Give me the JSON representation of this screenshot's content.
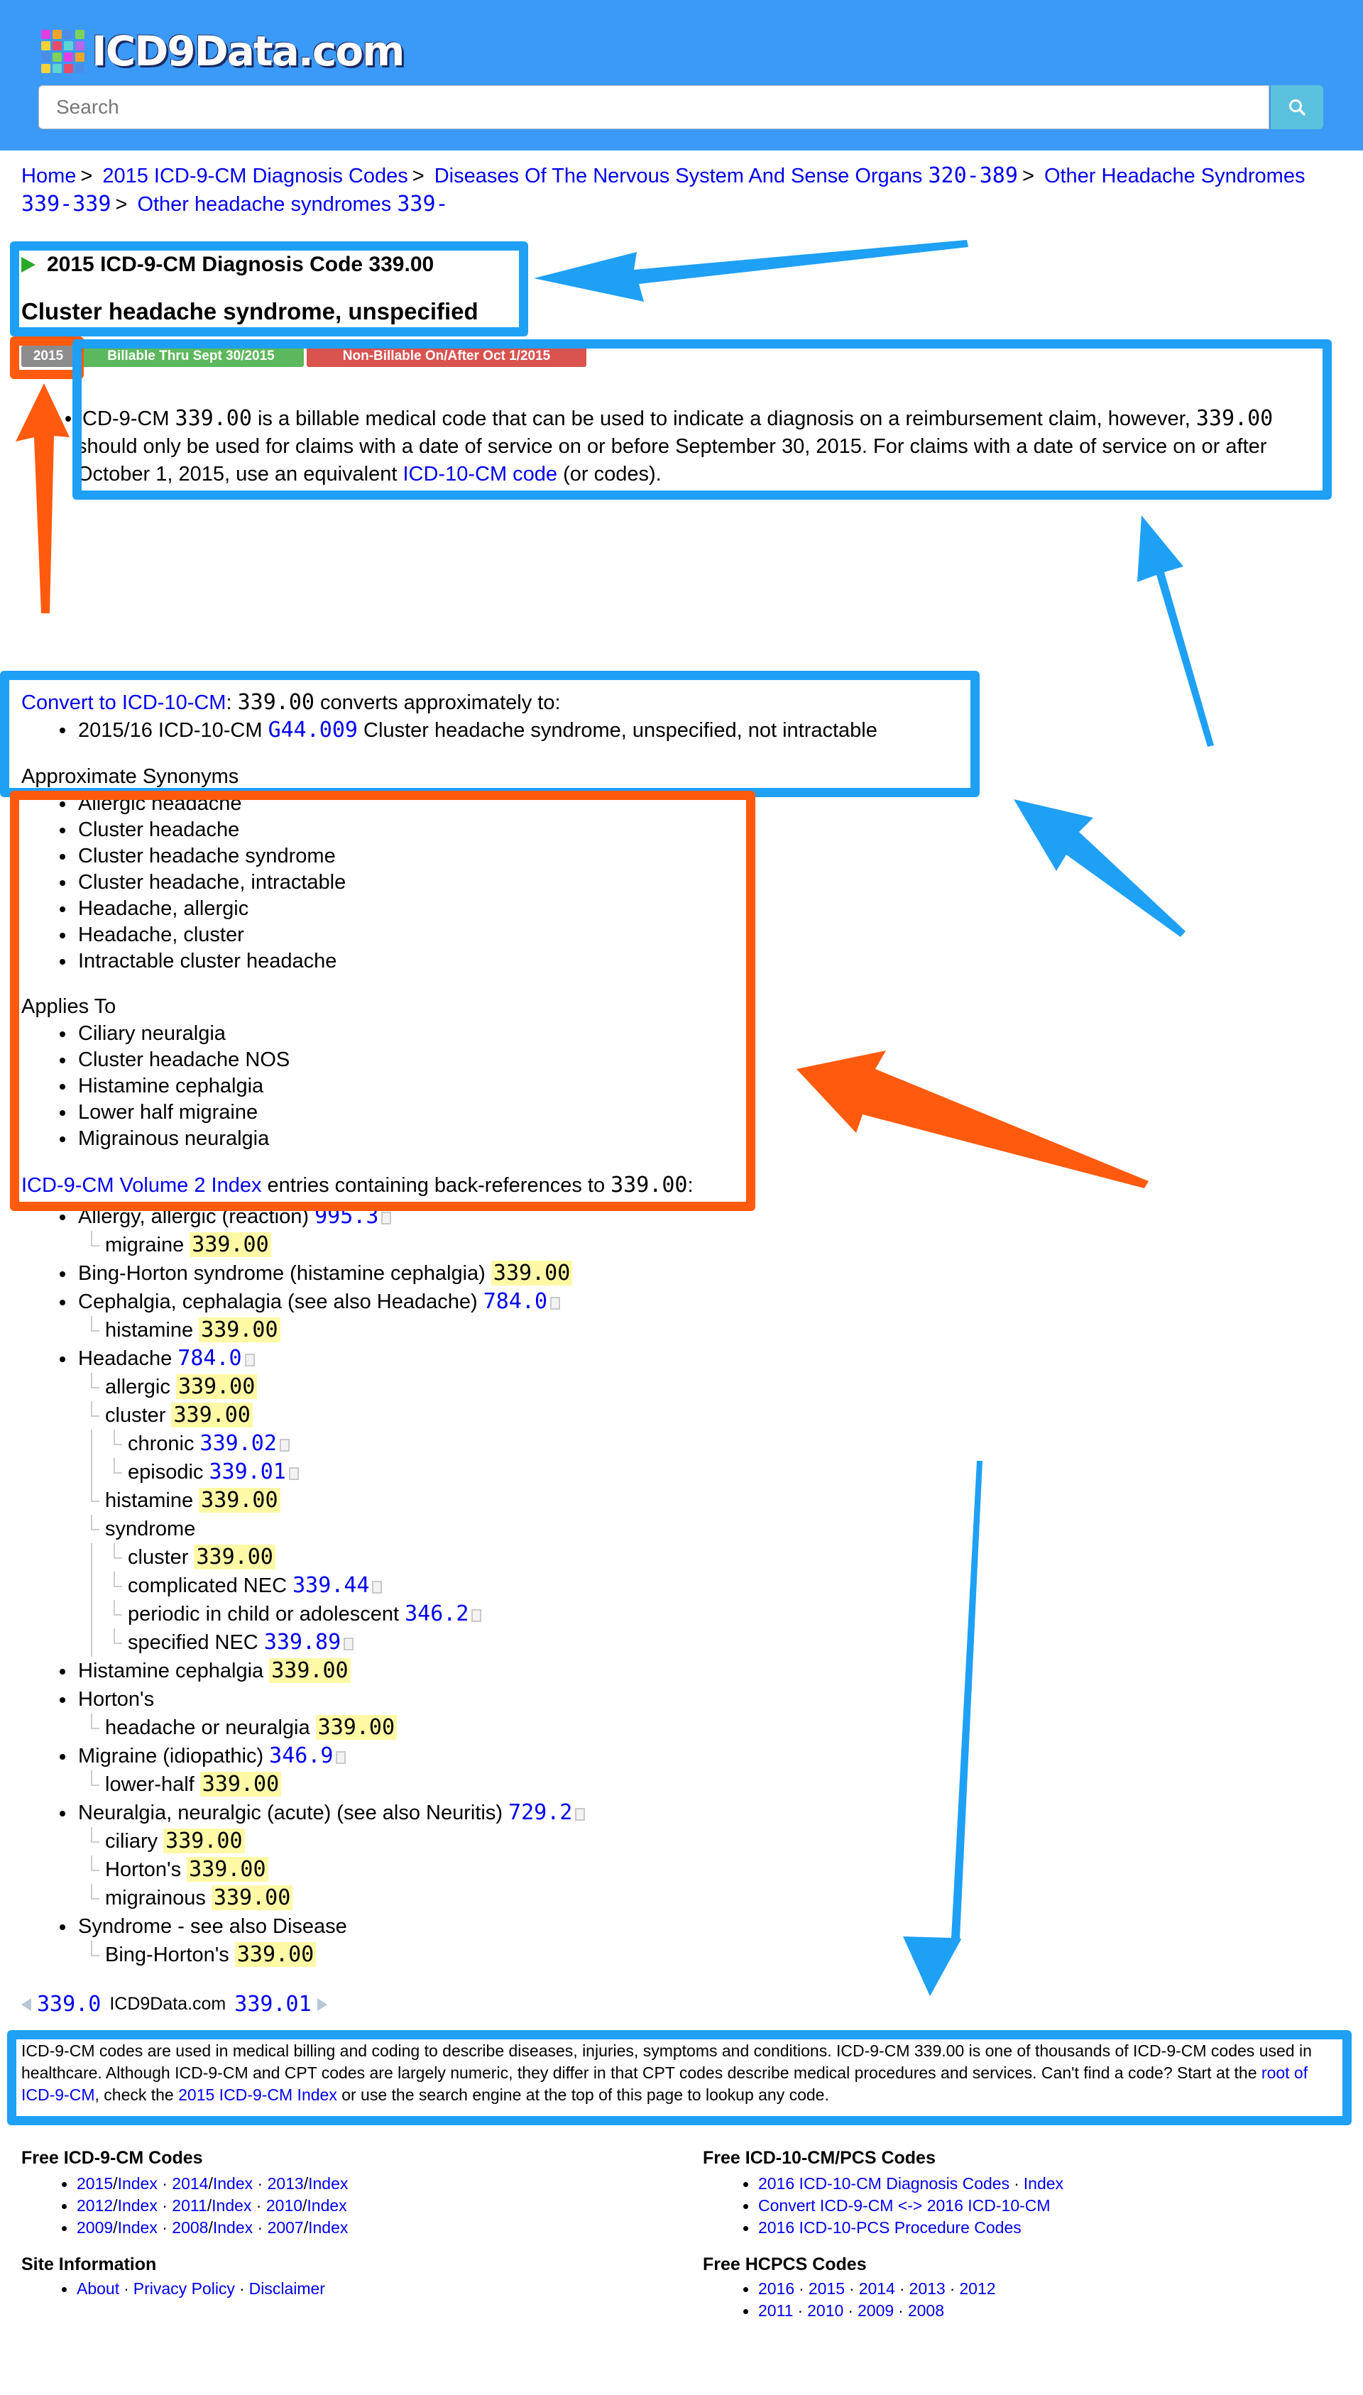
{
  "site": {
    "logo_text": "ICD9Data.com",
    "search_placeholder": "Search"
  },
  "breadcrumb": [
    {
      "text": "Home"
    },
    {
      "text": "2015 ICD-9-CM Diagnosis Codes"
    },
    {
      "text": "Diseases Of The Nervous System And Sense Organs",
      "code": "320-389"
    },
    {
      "text": "Other Headache Syndromes",
      "code": "339-339"
    },
    {
      "text": "Other headache syndromes",
      "code": "339-"
    }
  ],
  "title": {
    "heading": "2015 ICD-9-CM Diagnosis Code 339.00",
    "subtitle": "Cluster headache syndrome, unspecified"
  },
  "badges": {
    "year": "2015",
    "billable": "Billable Thru Sept 30/2015",
    "nonbillable": "Non-Billable On/After Oct 1/2015"
  },
  "description": {
    "p1": "ICD-9-CM ",
    "code1": "339.00",
    "p2": " is a billable medical code that can be used to indicate a diagnosis on a reimbursement claim, however, ",
    "code2": "339.00",
    "p3": " should only be used for claims with a date of service on or before September 30, 2015. For claims with a date of service on or after October 1, 2015, use an equivalent ",
    "link": "ICD-10-CM code",
    "p4": " (or codes)."
  },
  "convert": {
    "link": "Convert to ICD-10-CM",
    "colon": ": ",
    "code": "339.00",
    "text": " converts approximately to:",
    "item_prefix": "2015/16 ICD-10-CM ",
    "item_code": "G44.009",
    "item_text": " Cluster headache syndrome, unspecified, not intractable"
  },
  "synonyms": {
    "heading": "Approximate Synonyms",
    "items": [
      "Allergic headache",
      "Cluster headache",
      "Cluster headache syndrome",
      "Cluster headache, intractable",
      "Headache, allergic",
      "Headache, cluster",
      "Intractable cluster headache"
    ]
  },
  "applies_to": {
    "heading": "Applies To",
    "items": [
      "Ciliary neuralgia",
      "Cluster headache NOS",
      "Histamine cephalgia",
      "Lower half migraine",
      "Migrainous neuralgia"
    ]
  },
  "index": {
    "link": "ICD-9-CM Volume 2 Index",
    "text": " entries containing back-references to ",
    "code": "339.00",
    "colon": ":",
    "rows": [
      {
        "level": 0,
        "text": "Allergy, allergic (reaction) ",
        "code": "995.3",
        "hl": false,
        "doc": true
      },
      {
        "level": 1,
        "text": "migraine ",
        "code": "339.00",
        "hl": true,
        "doc": false
      },
      {
        "level": 0,
        "text": "Bing-Horton syndrome (histamine cephalgia) ",
        "code": "339.00",
        "hl": true,
        "doc": false
      },
      {
        "level": 0,
        "text": "Cephalgia, cephalagia (see also Headache) ",
        "code": "784.0",
        "hl": false,
        "doc": true
      },
      {
        "level": 1,
        "text": "histamine ",
        "code": "339.00",
        "hl": true,
        "doc": false
      },
      {
        "level": 0,
        "text": "Headache ",
        "code": "784.0",
        "hl": false,
        "doc": true
      },
      {
        "level": 1,
        "text": "allergic ",
        "code": "339.00",
        "hl": true,
        "doc": false
      },
      {
        "level": 1,
        "text": "cluster ",
        "code": "339.00",
        "hl": true,
        "doc": false
      },
      {
        "level": 2,
        "text": "chronic ",
        "code": "339.02",
        "hl": false,
        "doc": true
      },
      {
        "level": 2,
        "text": "episodic ",
        "code": "339.01",
        "hl": false,
        "doc": true
      },
      {
        "level": 1,
        "text": "histamine ",
        "code": "339.00",
        "hl": true,
        "doc": false
      },
      {
        "level": 1,
        "text": "syndrome",
        "code": "",
        "hl": false,
        "doc": false
      },
      {
        "level": 2,
        "text": "cluster ",
        "code": "339.00",
        "hl": true,
        "doc": false
      },
      {
        "level": 2,
        "text": "complicated NEC ",
        "code": "339.44",
        "hl": false,
        "doc": true
      },
      {
        "level": 2,
        "text": "periodic in child or adolescent ",
        "code": "346.2",
        "hl": false,
        "doc": true
      },
      {
        "level": 2,
        "text": "specified NEC ",
        "code": "339.89",
        "hl": false,
        "doc": true
      },
      {
        "level": 0,
        "text": "Histamine cephalgia ",
        "code": "339.00",
        "hl": true,
        "doc": false
      },
      {
        "level": 0,
        "text": "Horton's",
        "code": "",
        "hl": false,
        "doc": false
      },
      {
        "level": 1,
        "text": "headache or neuralgia ",
        "code": "339.00",
        "hl": true,
        "doc": false
      },
      {
        "level": 0,
        "text": "Migraine (idiopathic) ",
        "code": "346.9",
        "hl": false,
        "doc": true
      },
      {
        "level": 1,
        "text": "lower-half ",
        "code": "339.00",
        "hl": true,
        "doc": false
      },
      {
        "level": 0,
        "text": "Neuralgia, neuralgic (acute) (see also Neuritis) ",
        "code": "729.2",
        "hl": false,
        "doc": true
      },
      {
        "level": 1,
        "text": "ciliary ",
        "code": "339.00",
        "hl": true,
        "doc": false
      },
      {
        "level": 1,
        "text": "Horton's ",
        "code": "339.00",
        "hl": true,
        "doc": false
      },
      {
        "level": 1,
        "text": "migrainous ",
        "code": "339.00",
        "hl": true,
        "doc": false
      },
      {
        "level": 0,
        "text": "Syndrome - see also Disease",
        "code": "",
        "hl": false,
        "doc": false
      },
      {
        "level": 1,
        "text": "Bing-Horton's ",
        "code": "339.00",
        "hl": true,
        "doc": false
      }
    ]
  },
  "nav": {
    "prev": "339.0",
    "site": "ICD9Data.com",
    "next": "339.01"
  },
  "footer_text": {
    "p1": "ICD-9-CM codes are used in medical billing and coding to describe diseases, injuries, symptoms and conditions. ICD-9-CM 339.00 is one of thousands of ICD-9-CM codes used in healthcare. Although ICD-9-CM and CPT codes are largely numeric, they differ in that CPT codes describe medical procedures and services. Can't find a code? Start at the ",
    "link1": "root of ICD-9-CM",
    "p2": ", check the ",
    "link2": "2015 ICD-9-CM Index",
    "p3": " or use the search engine at the top of this page to lookup any code."
  },
  "footer": {
    "icd9": {
      "heading": "Free ICD-9-CM Codes",
      "rows": [
        [
          {
            "t": "2015"
          },
          {
            "t": "/"
          },
          {
            "t": "Index"
          },
          {
            "t": " · "
          },
          {
            "t": "2014"
          },
          {
            "t": "/"
          },
          {
            "t": "Index"
          },
          {
            "t": " · "
          },
          {
            "t": "2013"
          },
          {
            "t": "/"
          },
          {
            "t": "Index"
          }
        ],
        [
          {
            "t": "2012"
          },
          {
            "t": "/"
          },
          {
            "t": "Index"
          },
          {
            "t": " · "
          },
          {
            "t": "2011"
          },
          {
            "t": "/"
          },
          {
            "t": "Index"
          },
          {
            "t": " · "
          },
          {
            "t": "2010"
          },
          {
            "t": "/"
          },
          {
            "t": "Index"
          }
        ],
        [
          {
            "t": "2009"
          },
          {
            "t": "/"
          },
          {
            "t": "Index"
          },
          {
            "t": " · "
          },
          {
            "t": "2008"
          },
          {
            "t": "/"
          },
          {
            "t": "Index"
          },
          {
            "t": " · "
          },
          {
            "t": "2007"
          },
          {
            "t": "/"
          },
          {
            "t": "Index"
          }
        ]
      ]
    },
    "site_info": {
      "heading": "Site Information",
      "links": [
        "About",
        "Privacy Policy",
        "Disclaimer"
      ]
    },
    "icd10": {
      "heading": "Free ICD-10-CM/PCS Codes",
      "rows": [
        [
          "2016 ICD-10-CM Diagnosis Codes",
          "Index"
        ],
        [
          "Convert ICD-9-CM <-> 2016 ICD-10-CM"
        ],
        [
          "2016 ICD-10-PCS Procedure Codes"
        ]
      ]
    },
    "hcpcs": {
      "heading": "Free HCPCS Codes",
      "rows": [
        [
          "2016",
          "2015",
          "2014",
          "2013",
          "2012"
        ],
        [
          "2011",
          "2010",
          "2009",
          "2008"
        ]
      ]
    }
  },
  "colors": {
    "header_bg": "#3b99f7",
    "annotation_blue": "#1ea0f5",
    "annotation_orange": "#ff5a0e",
    "highlight": "#fff9a6",
    "badge_year": "#8c8c8c",
    "badge_billable": "#5cb85c",
    "badge_nonbillable": "#d9534f"
  }
}
